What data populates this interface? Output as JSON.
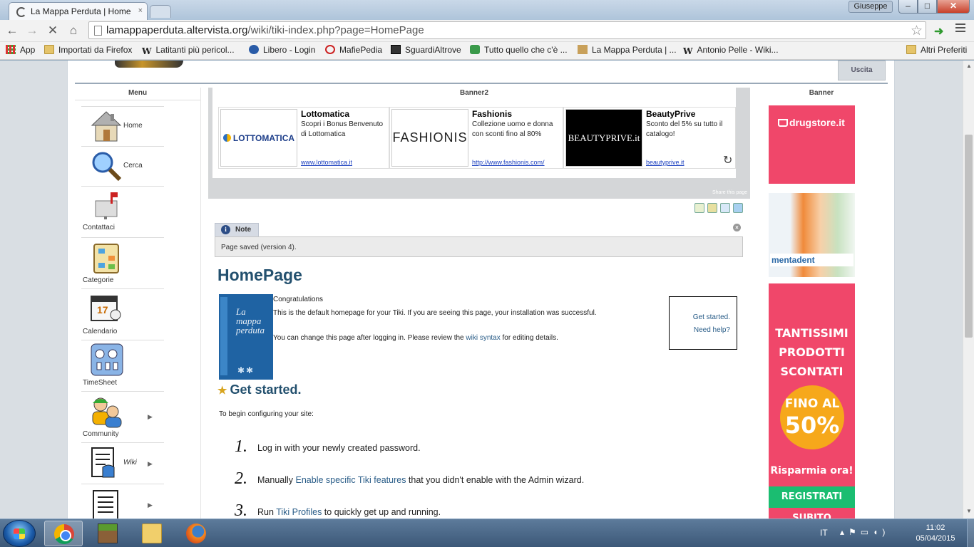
{
  "browser": {
    "tab_title": "La Mappa Perduta | Home",
    "tab_close": "×",
    "user": "Giuseppe",
    "url_domain": "lamappaperduta.altervista.org",
    "url_path": "/wiki/tiki-index.php?page=HomePage",
    "window_buttons": {
      "minimize": "–",
      "maximize": "□",
      "close": "✕"
    },
    "nav": {
      "back": "←",
      "forward": "→",
      "stop": "✕",
      "home": "⌂",
      "star": "☆"
    }
  },
  "bookmarks": [
    {
      "label": "App",
      "icon": "apps-grid-icon"
    },
    {
      "label": "Importati da Firefox",
      "icon": "folder-icon"
    },
    {
      "label": "Latitanti più pericol...",
      "icon": "wikipedia-icon"
    },
    {
      "label": "Libero - Login",
      "icon": "libero-icon"
    },
    {
      "label": "MafiePedia",
      "icon": "mafiepedia-icon"
    },
    {
      "label": "SguardiAltrove",
      "icon": "film-icon"
    },
    {
      "label": "Tutto quello che c'è ...",
      "icon": "phone-icon"
    },
    {
      "label": "La Mappa Perduta | ...",
      "icon": "map-icon"
    },
    {
      "label": "Antonio Pelle - Wiki...",
      "icon": "wikipedia-icon"
    }
  ],
  "bookmarks_other": "Altri Preferiti",
  "header": {
    "logout": "Uscita"
  },
  "left_menu": {
    "title": "Menu",
    "items": [
      {
        "label": "Home",
        "icon": "house-icon"
      },
      {
        "label": "Cerca",
        "icon": "magnifier-icon"
      },
      {
        "label": "Contattaci",
        "icon": "mailbox-icon"
      },
      {
        "label": "Categorie",
        "icon": "categories-icon"
      },
      {
        "label": "Calendario",
        "icon": "calendar-icon"
      },
      {
        "label": "TimeSheet",
        "icon": "timesheet-icon"
      },
      {
        "label": "Community",
        "icon": "community-icon"
      },
      {
        "label": "Wiki",
        "icon": "wiki-icon"
      },
      {
        "label": "",
        "icon": "document-list-icon"
      }
    ],
    "calendar_day": "17",
    "arrow": "▶"
  },
  "banner2": {
    "title": "Banner2",
    "ads": [
      {
        "title": "Lottomatica",
        "desc": "Scopri i Bonus Benvenuto di Lottomatica",
        "link": "www.lottomatica.it",
        "logo": "LOTTOMATICA"
      },
      {
        "title": "Fashionis",
        "desc": "Collezione uomo e donna con sconti fino al 80%",
        "link": "http://www.fashionis.com/",
        "logo": "FASHIONIS"
      },
      {
        "title": "BeautyPrive",
        "desc": "Sconto del 5% su tutto il catalogo!",
        "link": "beautyprive.it",
        "logo": "BEAUTYPRIVE.it"
      }
    ],
    "refresh": "↻",
    "share": "Share this page"
  },
  "note": {
    "label": "Note",
    "info": "i",
    "message": "Page saved (version 4).",
    "close": "×"
  },
  "page": {
    "title": "HomePage",
    "book_title_1": "La",
    "book_title_2": "mappa",
    "book_title_3": "perduta",
    "congrats": "Congratulations",
    "line1": "This is the default homepage for your Tiki. If you are seeing this page, your installation was successful.",
    "line2_pre": "You can change this page after logging in. Please review the ",
    "line2_link": "wiki syntax",
    "line2_post": " for editing details.",
    "quick_links": [
      "Get started.",
      "Need help?"
    ],
    "get_started_heading": "Get started.",
    "intro": "To begin configuring your site:",
    "steps": [
      {
        "num": "1.",
        "pre": "Log in with your newly created password.",
        "link": "",
        "post": ""
      },
      {
        "num": "2.",
        "pre": "Manually ",
        "link": "Enable specific Tiki features",
        "post": " that you didn't enable with the Admin wizard."
      },
      {
        "num": "3.",
        "pre": "Run ",
        "link": "Tiki Profiles",
        "post": " to quickly get up and running."
      }
    ]
  },
  "right_banner": {
    "title": "Banner",
    "drugstore": "drugstore.it",
    "products_label": "mentadent",
    "promo_lines": [
      "TANTISSIMI",
      "PRODOTTI",
      "SCONTATI"
    ],
    "promo_circle_1": "FINO AL",
    "promo_circle_2": "50%",
    "promo_cta": "Risparmia ora!",
    "promo_register": "REGISTRATI SUBITO"
  },
  "taskbar": {
    "lang": "IT",
    "time": "11:02",
    "date": "05/04/2015"
  }
}
